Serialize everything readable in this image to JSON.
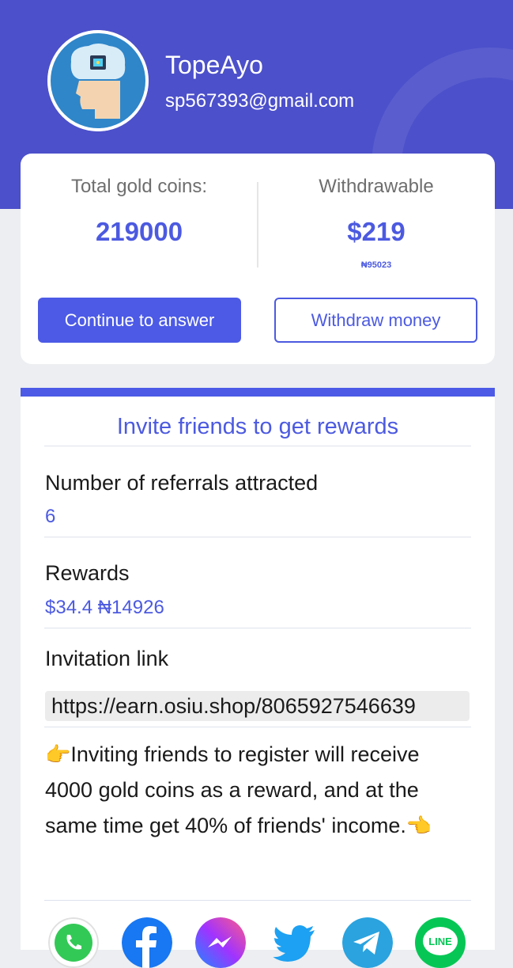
{
  "profile": {
    "name": "TopeAyo",
    "email": "sp567393@gmail.com"
  },
  "balance": {
    "total_label": "Total gold coins:",
    "total_value": "219000",
    "withdrawable_label": "Withdrawable",
    "withdrawable_value": "$219",
    "withdrawable_local": "₦95023",
    "continue_button": "Continue to answer",
    "withdraw_button": "Withdraw money"
  },
  "invite": {
    "title": "Invite friends to get rewards",
    "referrals_label": "Number of referrals attracted",
    "referrals_value": "6",
    "rewards_label": "Rewards",
    "rewards_value": "$34.4 ₦14926",
    "link_label": "Invitation link",
    "link_value": "https://earn.osiu.shop/8065927546639",
    "note_hand_left": "👉",
    "note_text": "Inviting friends to register will receive 4000 gold coins as a reward, and at the same time get 40% of friends' income.",
    "note_hand_right": "👈"
  },
  "share": {
    "icons": [
      "whatsapp-icon",
      "facebook-icon",
      "messenger-icon",
      "twitter-icon",
      "telegram-icon",
      "line-icon"
    ],
    "line_text": "LINE"
  },
  "colors": {
    "header": "#4c50ca",
    "accent": "#4c5ae6",
    "background": "#eceef1"
  }
}
